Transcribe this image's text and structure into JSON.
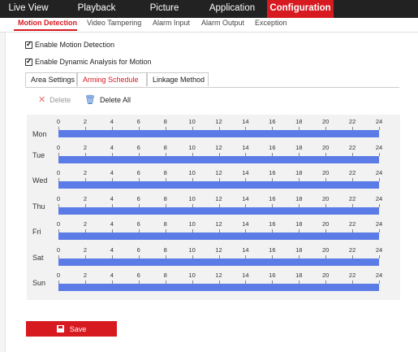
{
  "topnav": {
    "items": [
      {
        "label": "Live View"
      },
      {
        "label": "Playback"
      },
      {
        "label": "Picture"
      },
      {
        "label": "Application"
      },
      {
        "label": "Configuration",
        "active": true
      }
    ]
  },
  "subtabs": {
    "items": [
      {
        "label": "Motion Detection",
        "active": true
      },
      {
        "label": "Video Tampering"
      },
      {
        "label": "Alarm Input"
      },
      {
        "label": "Alarm Output"
      },
      {
        "label": "Exception"
      }
    ]
  },
  "options": {
    "enable_motion": {
      "label": "Enable Motion Detection",
      "checked": true
    },
    "enable_dynamic": {
      "label": "Enable Dynamic Analysis for Motion",
      "checked": true
    }
  },
  "inner_tabs": {
    "items": [
      {
        "label": "Area Settings"
      },
      {
        "label": "Arming Schedule",
        "active": true
      },
      {
        "label": "Linkage Method"
      }
    ]
  },
  "toolbar": {
    "delete_label": "Delete",
    "delete_all_label": "Delete All"
  },
  "schedule": {
    "hours": [
      "0",
      "2",
      "4",
      "6",
      "8",
      "10",
      "12",
      "14",
      "16",
      "18",
      "20",
      "22",
      "24"
    ],
    "days": [
      {
        "label": "Mon",
        "start": 0,
        "end": 24
      },
      {
        "label": "Tue",
        "start": 0,
        "end": 24
      },
      {
        "label": "Wed",
        "start": 0,
        "end": 24
      },
      {
        "label": "Thu",
        "start": 0,
        "end": 24
      },
      {
        "label": "Fri",
        "start": 0,
        "end": 24
      },
      {
        "label": "Sat",
        "start": 0,
        "end": 24
      },
      {
        "label": "Sun",
        "start": 0,
        "end": 24
      }
    ],
    "bar_color": "#5b7be6"
  },
  "save_label": "Save",
  "accent_color": "#d71920"
}
